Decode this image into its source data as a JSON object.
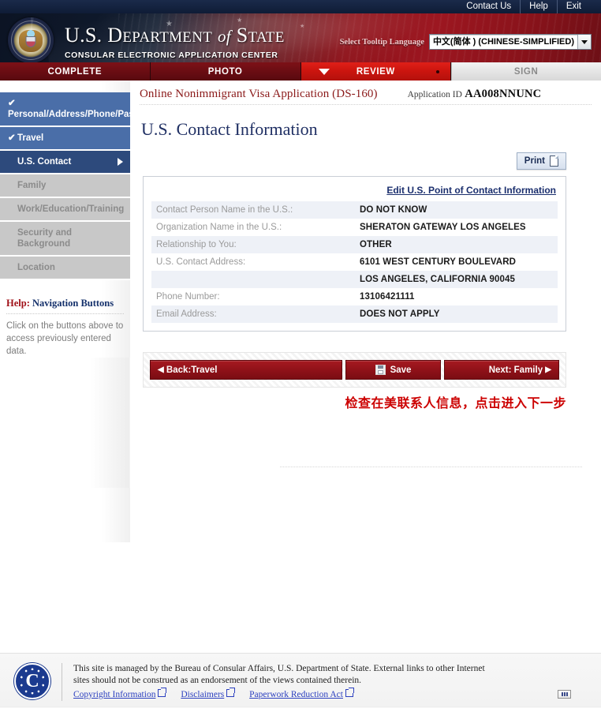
{
  "topbar": {
    "links": [
      {
        "label": "Contact Us",
        "name": "contact-us-link"
      },
      {
        "label": "Help",
        "name": "help-link"
      },
      {
        "label": "Exit",
        "name": "exit-link"
      }
    ]
  },
  "masthead": {
    "title_line1_a": "U.S. D",
    "title_line1_b": "EPARTMENT",
    "title_line1_it": "of",
    "title_line1_c": "S",
    "title_line1_d": "TATE",
    "subtitle": "CONSULAR ELECTRONIC APPLICATION CENTER",
    "seal_alt": "department-of-state-seal",
    "tooltip_language_label": "Select Tooltip Language",
    "tooltip_language_value": "中文(简体 ) (CHINESE-SIMPLIFIED)"
  },
  "tabs": [
    {
      "label": "COMPLETE",
      "state": "done"
    },
    {
      "label": "PHOTO",
      "state": "done"
    },
    {
      "label": "REVIEW",
      "state": "current"
    },
    {
      "label": "SIGN",
      "state": "future"
    }
  ],
  "appbar": {
    "application_title": "Online Nonimmigrant Visa Application (DS-160)",
    "application_id_label": "Application ID",
    "application_id_value": "AA008NNUNC"
  },
  "page": {
    "title": "U.S. Contact Information"
  },
  "toolbar": {
    "print_label": "Print"
  },
  "sidebar": {
    "items": [
      {
        "label": "Personal/Address/Phone/Passport",
        "state": "visited",
        "check": "✔",
        "name": "sidebar-item-personal"
      },
      {
        "label": "Travel",
        "state": "visited",
        "check": "✔",
        "name": "sidebar-item-travel"
      },
      {
        "label": "U.S. Contact",
        "state": "active",
        "check": "",
        "name": "sidebar-item-us-contact"
      },
      {
        "label": "Family",
        "state": "pending",
        "check": "",
        "name": "sidebar-item-family"
      },
      {
        "label": "Work/Education/Training",
        "state": "pending",
        "check": "",
        "name": "sidebar-item-work"
      },
      {
        "label": "Security and Background",
        "state": "pending",
        "check": "",
        "name": "sidebar-item-security"
      },
      {
        "label": "Location",
        "state": "pending",
        "check": "",
        "name": "sidebar-item-location"
      }
    ],
    "help": {
      "title_word": "Help:",
      "title_rest": " Navigation Buttons",
      "body": "Click on the buttons above to access previously entered data."
    }
  },
  "panel": {
    "edit_link": "Edit U.S. Point of Contact Information",
    "rows": [
      {
        "label": "Contact Person Name in the U.S.:",
        "value": "DO NOT KNOW"
      },
      {
        "label": "Organization Name in the U.S.:",
        "value": "SHERATON GATEWAY LOS ANGELES"
      },
      {
        "label": "Relationship to You:",
        "value": "OTHER"
      },
      {
        "label": "U.S. Contact Address:",
        "value": "6101 WEST CENTURY BOULEVARD"
      },
      {
        "label": "",
        "value": "LOS ANGELES, CALIFORNIA 90045"
      },
      {
        "label": "Phone Number:",
        "value": "13106421111"
      },
      {
        "label": "Email Address:",
        "value": "DOES NOT APPLY"
      }
    ]
  },
  "navigation": {
    "back_label": "Back:Travel",
    "back_arrow": "◀",
    "save_label": "Save",
    "next_label": "Next: Family",
    "next_arrow": "▶"
  },
  "annotation": {
    "text": "检查在美联系人信息，点击进入下一步",
    "color": "#cc0000"
  },
  "footer": {
    "seal_letter": "C",
    "notice_line1": "This site is managed by the Bureau of Consular Affairs, U.S. Department of State. External links to other Internet",
    "notice_line2": "sites should not be construed as an endorsement of the views contained therein.",
    "links": [
      {
        "label": "Copyright Information",
        "name": "copyright-information-link"
      },
      {
        "label": "Disclaimers",
        "name": "disclaimers-link"
      },
      {
        "label": "Paperwork Reduction Act",
        "name": "paperwork-reduction-act-link"
      }
    ]
  },
  "colors": {
    "brand_red": "#8e1118",
    "brand_navy": "#1f2f63",
    "sidebar_visited": "#4a6ea8",
    "sidebar_active": "#2d4a7c",
    "sidebar_pending": "#c8c8c8"
  }
}
